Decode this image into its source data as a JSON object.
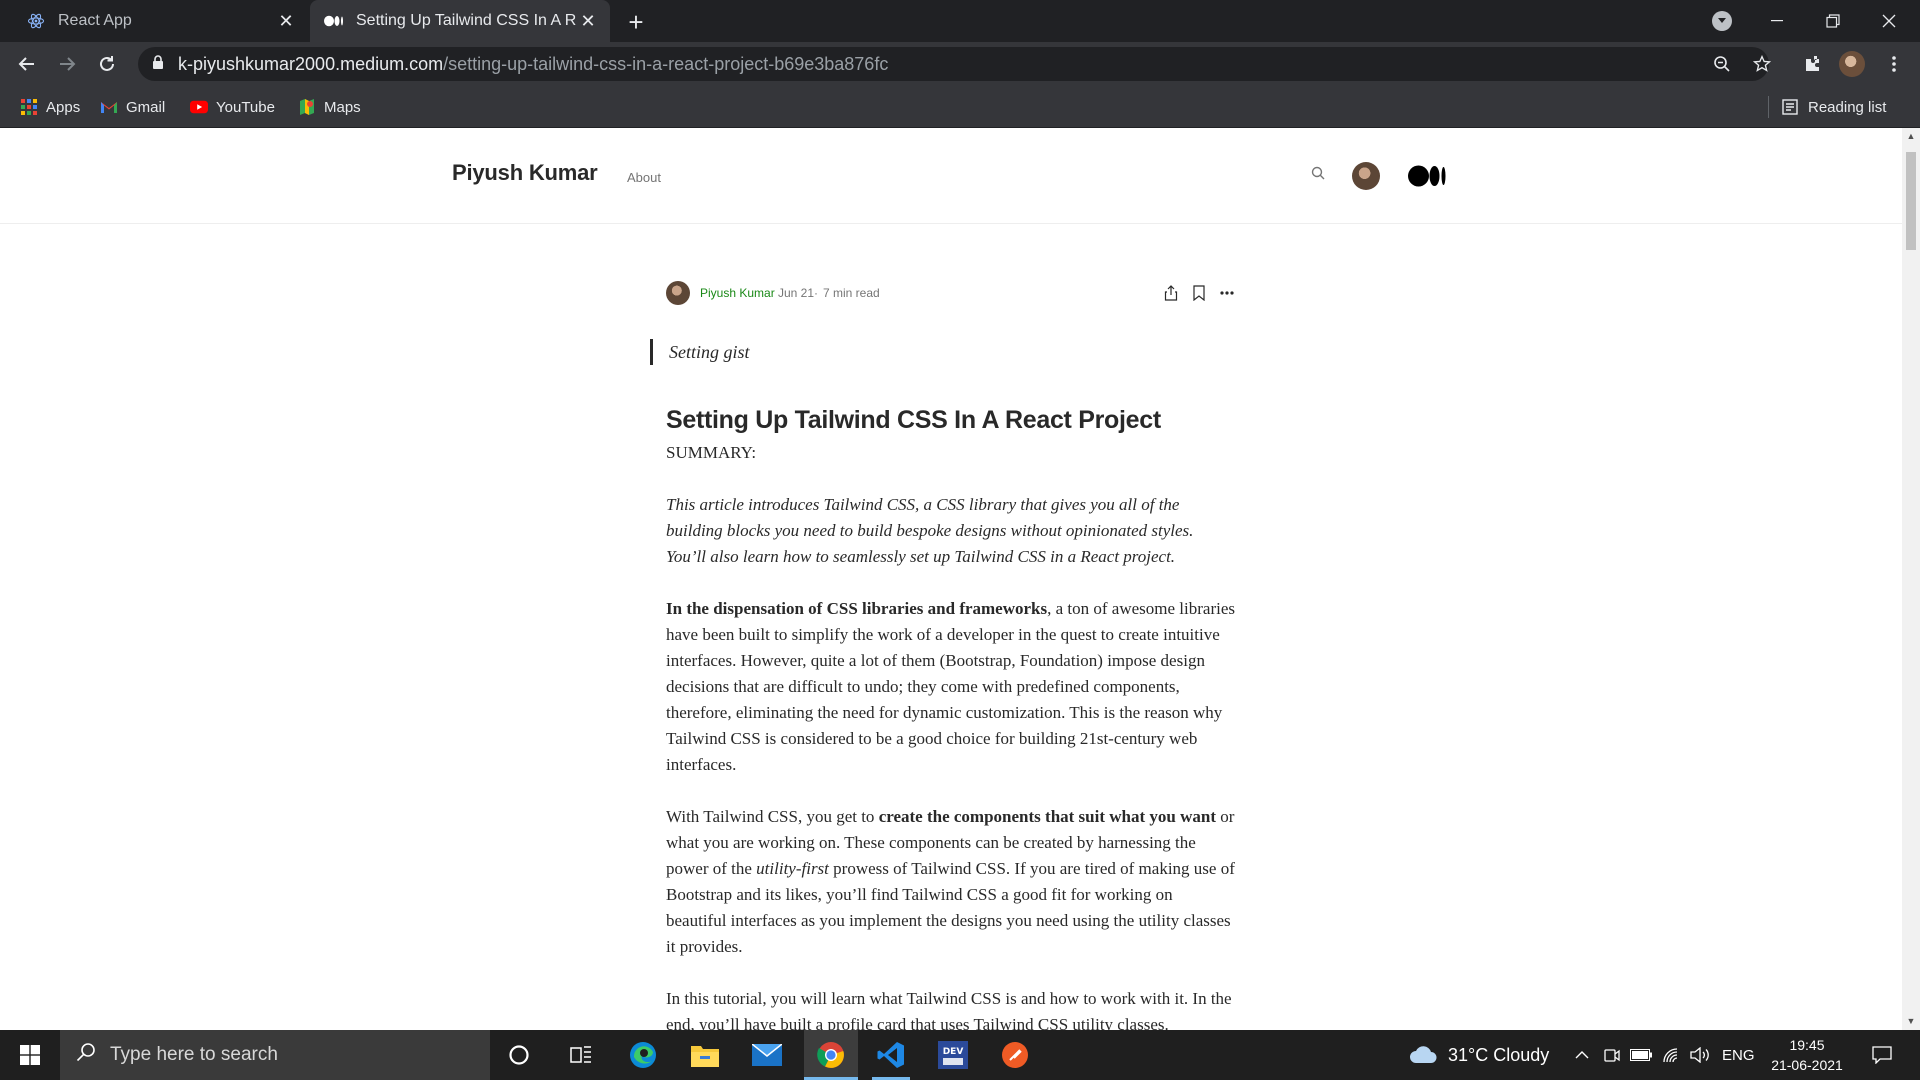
{
  "browser": {
    "tabs": [
      {
        "title": "React App",
        "icon": "react-icon",
        "active": false
      },
      {
        "title": "Setting Up Tailwind CSS In A React Project | by Piyush Kumar | Medium",
        "icon": "medium-icon",
        "active": true
      }
    ],
    "url_host": "k-piyushkumar2000.medium.com",
    "url_path": "/setting-up-tailwind-css-in-a-react-project-b69e3ba876fc",
    "bookmarks": [
      {
        "label": "Apps",
        "icon": "apps-grid-icon"
      },
      {
        "label": "Gmail",
        "icon": "gmail-icon"
      },
      {
        "label": "YouTube",
        "icon": "youtube-icon"
      },
      {
        "label": "Maps",
        "icon": "maps-icon"
      }
    ],
    "reading_list": "Reading list"
  },
  "site": {
    "name": "Piyush Kumar",
    "about": "About"
  },
  "meta": {
    "author": "Piyush Kumar",
    "date": "Jun 21",
    "dot": "·",
    "read_time": "7 min read"
  },
  "article": {
    "quote": "Setting gist",
    "title": "Setting Up Tailwind CSS In A React Project",
    "summary_label": "SUMMARY:",
    "intro": "This article introduces Tailwind CSS, a CSS library that gives you all of the building blocks you need to build bespoke designs without opinionated styles. You’ll also learn how to seamlessly set up Tailwind CSS in a React project.",
    "p1_bold": "In the dispensation of CSS libraries and frameworks",
    "p1_rest": ", a ton of awesome libraries have been built to simplify the work of a developer in the quest to create intuitive interfaces. However, quite a lot of them (Bootstrap, Foundation) impose design decisions that are difficult to undo; they come with predefined components, therefore, eliminating the need for dynamic customization. This is the reason why Tailwind CSS is considered to be a good choice for building 21st-century web interfaces.",
    "p2_a": "With Tailwind CSS, you get to ",
    "p2_bold": "create the components that suit what you want",
    "p2_b": " or what you are working on. These components can be created by harnessing the power of the ",
    "p2_em": "utility-first",
    "p2_c": " prowess of Tailwind CSS. If you are tired of making use of Bootstrap and its likes, you’ll find Tailwind CSS a good fit for working on beautiful interfaces as you implement the designs you need using the utility classes it provides.",
    "p3": "In this tutorial, you will learn what Tailwind CSS is and how to work with it. In the end, you’ll have built a profile card that uses Tailwind CSS utility classes."
  },
  "taskbar": {
    "search_placeholder": "Type here to search",
    "weather": "31°C  Cloudy",
    "language": "ENG",
    "time": "19:45",
    "date": "21-06-2021"
  },
  "colors": {
    "medium_green": "#1a8917",
    "chrome_dark": "#202124",
    "chrome_toolbar": "#35363a",
    "taskbar": "#1f1f1f"
  }
}
